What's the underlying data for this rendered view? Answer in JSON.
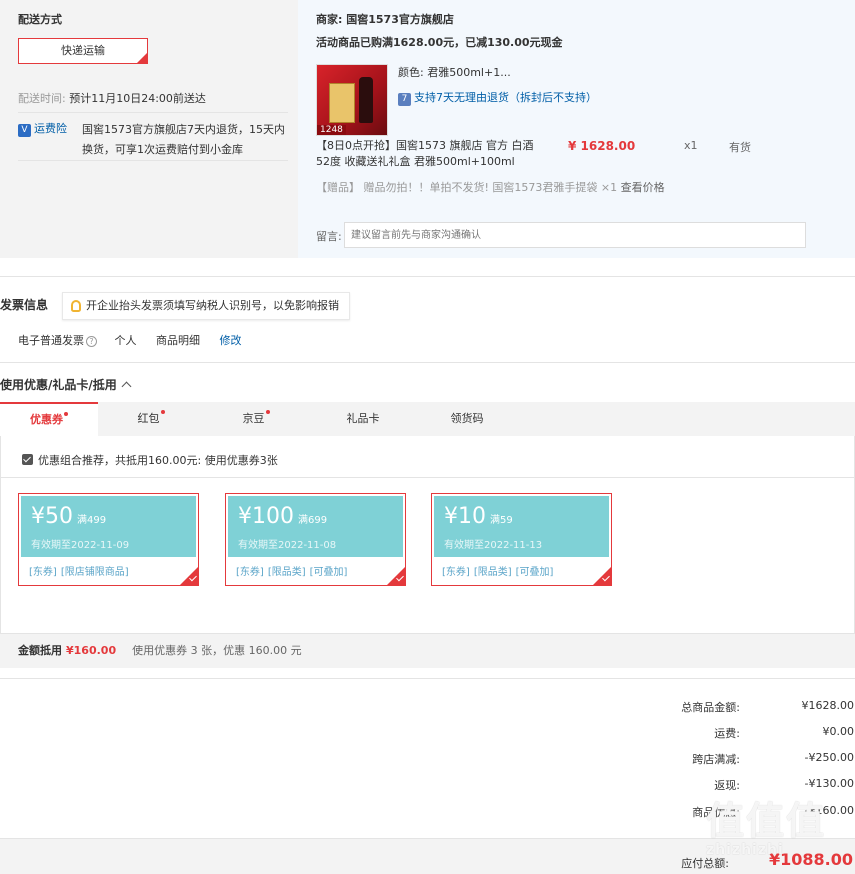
{
  "shipping": {
    "title": "配送方式",
    "method": "快递运输",
    "time_label": "配送时间:",
    "time_value": "预计11月10日24:00前送达",
    "insurance_badge": "运费险",
    "insurance_text": "国窖1573官方旗舰店7天内退货，15天内换货，可享1次运费赔付到小金库"
  },
  "seller": {
    "name": "商家: 国窖1573官方旗舰店",
    "promo": "活动商品已购满1628.00元，已减130.00元现金",
    "product": {
      "image_tag": "1248",
      "color_label": "颜色:",
      "color_value": "君雅500ml+1...",
      "return_icon": "7",
      "return_policy": "支持7天无理由退货（拆封后不支持）",
      "name": "【8日0点开抢】国窖1573 旗舰店 官方 白酒 52度 收藏送礼礼盒 君雅500ml+100ml",
      "price": "¥ 1628.00",
      "qty": "x1",
      "stock": "有货"
    },
    "gift": {
      "prefix": "【赠品】",
      "note": "赠品勿拍！！单拍不发货!",
      "item": "国窖1573君雅手提袋 ×1",
      "link": "查看价格"
    },
    "note_label": "留言:",
    "note_placeholder": "建议留言前先与商家沟通确认"
  },
  "invoice": {
    "title": "发票信息",
    "tip": "开企业抬头发票须填写纳税人识别号，以免影响报销",
    "type": "电子普通发票",
    "type_icon": "?",
    "holder": "个人",
    "content": "商品明细",
    "edit": "修改"
  },
  "coupons": {
    "title": "使用优惠/礼品卡/抵用",
    "tabs": [
      {
        "label": "优惠券"
      },
      {
        "label": "红包"
      },
      {
        "label": "京豆"
      },
      {
        "label": "礼品卡"
      },
      {
        "label": "领货码"
      }
    ],
    "recommend": "优惠组合推荐，共抵用160.00元: 使用优惠券3张",
    "items": [
      {
        "amount": "¥50",
        "threshold": "满499",
        "expire": "有效期至2022-11-09",
        "tags": [
          "[东券]",
          "[限店铺限商品]"
        ]
      },
      {
        "amount": "¥100",
        "threshold": "满699",
        "expire": "有效期至2022-11-08",
        "tags": [
          "[东券]",
          "[限品类]",
          "[可叠加]"
        ]
      },
      {
        "amount": "¥10",
        "threshold": "满59",
        "expire": "有效期至2022-11-13",
        "tags": [
          "[东券]",
          "[限品类]",
          "[可叠加]"
        ]
      }
    ],
    "deduct_label": "金额抵用",
    "deduct_value": "¥160.00",
    "deduct_desc": "使用优惠券 3 张，优惠 160.00 元"
  },
  "totals": {
    "rows": [
      {
        "label": "总商品金额:",
        "value": "¥1628.00"
      },
      {
        "label": "运费:",
        "value": "¥0.00"
      },
      {
        "label": "跨店满减:",
        "value": "-¥250.00"
      },
      {
        "label": "返现:",
        "value": "-¥130.00"
      },
      {
        "label": "商品优惠:",
        "value": "-¥160.00"
      }
    ],
    "final_label": "应付总额:",
    "final_value": "¥1088.00"
  },
  "watermark": {
    "mark": "值值值",
    "site": "zhizhizhi"
  },
  "colors": {
    "accent": "#e4393c",
    "link": "#005ea7",
    "coupon": "#7fd1d6",
    "seller_bg": "#f3f8fd"
  }
}
